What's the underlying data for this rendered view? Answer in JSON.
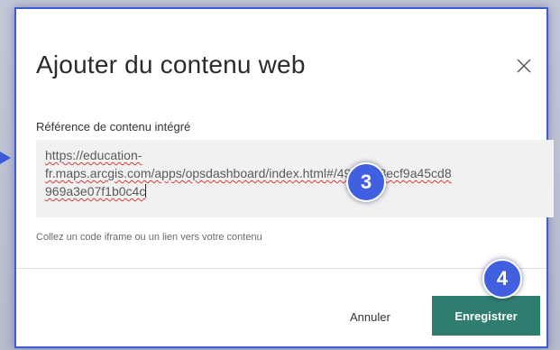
{
  "dialog": {
    "title": "Ajouter du contenu web",
    "close_icon": "close-icon"
  },
  "field": {
    "label": "Référence de contenu intégré",
    "value_lines": [
      "https://education-",
      "fr.maps.arcgis.com/apps/opsdashboard/index.html#/49bd913ecf9a45cd8",
      "969a3e07f1b0c4c"
    ],
    "hint": "Collez un code iframe ou un lien vers votre contenu"
  },
  "footer": {
    "cancel_label": "Annuler",
    "save_label": "Enregistrer"
  },
  "annotations": {
    "step_3": "3",
    "step_4": "4"
  },
  "colors": {
    "accent_border": "#3e5ad8",
    "badge": "#4060e0",
    "save_button": "#2f7d6e"
  }
}
